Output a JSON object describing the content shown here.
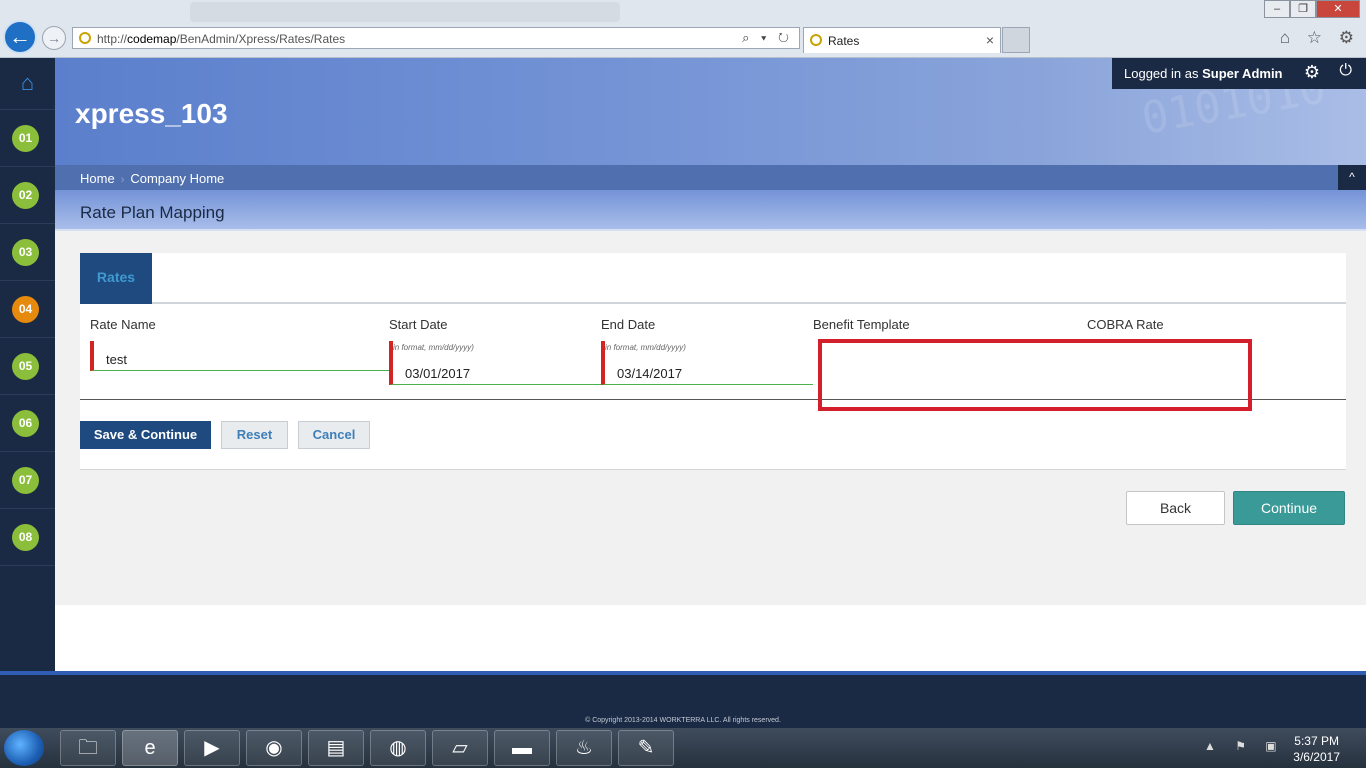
{
  "browser": {
    "url_prefix": "http://",
    "url_host": "codemap",
    "url_path": "/BenAdmin/Xpress/Rates/Rates",
    "tab_title": "Rates",
    "tab_close": "×",
    "url_tools": "⌕ ▾ ↻",
    "window_buttons": {
      "minimize": "–",
      "maximize": "❐",
      "close": "✕"
    },
    "right_icons": "⌂ ☆ ⚙"
  },
  "rail": {
    "home_icon": "⌂",
    "steps": [
      "01",
      "02",
      "03",
      "04",
      "05",
      "06",
      "07",
      "08"
    ],
    "active_step": "04"
  },
  "header": {
    "app_title": "xpress_103",
    "logged_in_prefix": "Logged in as",
    "user_name": "Super Admin",
    "gear_glyph": "⚙",
    "power_glyph": "⏻",
    "deco_text": "0101010"
  },
  "breadcrumb": {
    "items": [
      "Home",
      "Company Home"
    ],
    "separator": "›",
    "collapse_glyph": "^"
  },
  "page": {
    "title": "Rate Plan Mapping"
  },
  "form": {
    "tab_label": "Rates",
    "labels": {
      "rate_name": "Rate Name",
      "start_date": "Start Date",
      "end_date": "End Date",
      "benefit_template": "Benefit Template",
      "cobra_rate": "COBRA Rate"
    },
    "values": {
      "rate_name": "test",
      "start_date": "03/01/2017",
      "end_date": "03/14/2017"
    },
    "date_hint": "in format, mm/dd/yyyy)",
    "buttons": {
      "save": "Save & Continue",
      "reset": "Reset",
      "cancel": "Cancel"
    }
  },
  "nav": {
    "back": "Back",
    "continue": "Continue"
  },
  "footer": {
    "copyright": "© Copyright 2013-2014 WORKTERRA LLC. All rights reserved."
  },
  "taskbar": {
    "tray_icons": "▲ ⚑ ▣",
    "time": "5:37 PM",
    "date": "3/6/2017"
  },
  "colors": {
    "rail": "#1b2a44",
    "primary": "#1e4a7f",
    "step_green": "#8bbf3b",
    "step_active": "#e58a0c",
    "continue": "#3a9a97",
    "highlight": "#d21f2b"
  }
}
